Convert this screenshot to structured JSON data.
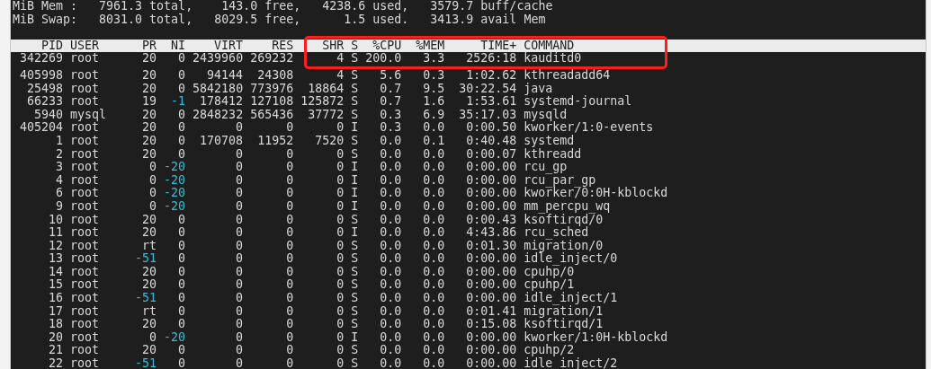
{
  "summary_lines": [
    "MiB Mem :   7961.3 total,    143.0 free,   4238.6 used,   3579.7 buff/cache",
    "MiB Swap:   8031.0 total,   8029.5 free,      1.5 used.   3413.9 avail Mem"
  ],
  "header": {
    "columns": [
      "PID",
      "USER",
      "PR",
      "NI",
      "VIRT",
      "RES",
      "SHR",
      "S",
      "%CPU",
      "%MEM",
      "TIME+",
      "COMMAND"
    ],
    "boxed": true
  },
  "rows": [
    {
      "pid": "342269",
      "user": "root",
      "pr": "20",
      "ni": "0",
      "virt": "2439960",
      "res": "269232",
      "shr": "4",
      "s": "S",
      "cpu": "200.0",
      "mem": "3.3",
      "time": "2526:18",
      "command": "kauditd0",
      "pr_highlighted": false,
      "ni_highlighted": false,
      "boxed": true
    },
    {
      "pid": "405998",
      "user": "root",
      "pr": "20",
      "ni": "0",
      "virt": "94144",
      "res": "24308",
      "shr": "4",
      "s": "S",
      "cpu": "5.6",
      "mem": "0.3",
      "time": "1:02.62",
      "command": "kthreadadd64",
      "pr_highlighted": false,
      "ni_highlighted": false,
      "boxed": false
    },
    {
      "pid": "25498",
      "user": "root",
      "pr": "20",
      "ni": "0",
      "virt": "5842180",
      "res": "773976",
      "shr": "18864",
      "s": "S",
      "cpu": "0.7",
      "mem": "9.5",
      "time": "30:22.54",
      "command": "java",
      "pr_highlighted": false,
      "ni_highlighted": false,
      "boxed": false
    },
    {
      "pid": "66233",
      "user": "root",
      "pr": "19",
      "ni": "-1",
      "virt": "178412",
      "res": "127108",
      "shr": "125872",
      "s": "S",
      "cpu": "0.7",
      "mem": "1.6",
      "time": "1:53.61",
      "command": "systemd-journal",
      "pr_highlighted": false,
      "ni_highlighted": true,
      "boxed": false
    },
    {
      "pid": "5940",
      "user": "mysql",
      "pr": "20",
      "ni": "0",
      "virt": "2848232",
      "res": "565436",
      "shr": "37772",
      "s": "S",
      "cpu": "0.3",
      "mem": "6.9",
      "time": "35:17.03",
      "command": "mysqld",
      "pr_highlighted": false,
      "ni_highlighted": false,
      "boxed": false
    },
    {
      "pid": "405204",
      "user": "root",
      "pr": "20",
      "ni": "0",
      "virt": "0",
      "res": "0",
      "shr": "0",
      "s": "I",
      "cpu": "0.3",
      "mem": "0.0",
      "time": "0:00.50",
      "command": "kworker/1:0-events",
      "pr_highlighted": false,
      "ni_highlighted": false,
      "boxed": false
    },
    {
      "pid": "1",
      "user": "root",
      "pr": "20",
      "ni": "0",
      "virt": "170708",
      "res": "11952",
      "shr": "7520",
      "s": "S",
      "cpu": "0.0",
      "mem": "0.1",
      "time": "0:40.48",
      "command": "systemd",
      "pr_highlighted": false,
      "ni_highlighted": false,
      "boxed": false
    },
    {
      "pid": "2",
      "user": "root",
      "pr": "20",
      "ni": "0",
      "virt": "0",
      "res": "0",
      "shr": "0",
      "s": "S",
      "cpu": "0.0",
      "mem": "0.0",
      "time": "0:00.07",
      "command": "kthreadd",
      "pr_highlighted": false,
      "ni_highlighted": false,
      "boxed": false
    },
    {
      "pid": "3",
      "user": "root",
      "pr": "0",
      "ni": "-20",
      "virt": "0",
      "res": "0",
      "shr": "0",
      "s": "I",
      "cpu": "0.0",
      "mem": "0.0",
      "time": "0:00.00",
      "command": "rcu_gp",
      "pr_highlighted": false,
      "ni_highlighted": true,
      "boxed": false
    },
    {
      "pid": "4",
      "user": "root",
      "pr": "0",
      "ni": "-20",
      "virt": "0",
      "res": "0",
      "shr": "0",
      "s": "I",
      "cpu": "0.0",
      "mem": "0.0",
      "time": "0:00.00",
      "command": "rcu_par_gp",
      "pr_highlighted": false,
      "ni_highlighted": true,
      "boxed": false
    },
    {
      "pid": "6",
      "user": "root",
      "pr": "0",
      "ni": "-20",
      "virt": "0",
      "res": "0",
      "shr": "0",
      "s": "I",
      "cpu": "0.0",
      "mem": "0.0",
      "time": "0:00.00",
      "command": "kworker/0:0H-kblockd",
      "pr_highlighted": false,
      "ni_highlighted": true,
      "boxed": false
    },
    {
      "pid": "9",
      "user": "root",
      "pr": "0",
      "ni": "-20",
      "virt": "0",
      "res": "0",
      "shr": "0",
      "s": "I",
      "cpu": "0.0",
      "mem": "0.0",
      "time": "0:00.00",
      "command": "mm_percpu_wq",
      "pr_highlighted": false,
      "ni_highlighted": true,
      "boxed": false
    },
    {
      "pid": "10",
      "user": "root",
      "pr": "20",
      "ni": "0",
      "virt": "0",
      "res": "0",
      "shr": "0",
      "s": "S",
      "cpu": "0.0",
      "mem": "0.0",
      "time": "0:00.43",
      "command": "ksoftirqd/0",
      "pr_highlighted": false,
      "ni_highlighted": false,
      "boxed": false
    },
    {
      "pid": "11",
      "user": "root",
      "pr": "20",
      "ni": "0",
      "virt": "0",
      "res": "0",
      "shr": "0",
      "s": "I",
      "cpu": "0.0",
      "mem": "0.0",
      "time": "4:43.86",
      "command": "rcu_sched",
      "pr_highlighted": false,
      "ni_highlighted": false,
      "boxed": false
    },
    {
      "pid": "12",
      "user": "root",
      "pr": "rt",
      "ni": "0",
      "virt": "0",
      "res": "0",
      "shr": "0",
      "s": "S",
      "cpu": "0.0",
      "mem": "0.0",
      "time": "0:01.30",
      "command": "migration/0",
      "pr_highlighted": false,
      "ni_highlighted": false,
      "boxed": false
    },
    {
      "pid": "13",
      "user": "root",
      "pr": "-51",
      "ni": "0",
      "virt": "0",
      "res": "0",
      "shr": "0",
      "s": "S",
      "cpu": "0.0",
      "mem": "0.0",
      "time": "0:00.00",
      "command": "idle_inject/0",
      "pr_highlighted": true,
      "ni_highlighted": false,
      "boxed": false
    },
    {
      "pid": "14",
      "user": "root",
      "pr": "20",
      "ni": "0",
      "virt": "0",
      "res": "0",
      "shr": "0",
      "s": "S",
      "cpu": "0.0",
      "mem": "0.0",
      "time": "0:00.00",
      "command": "cpuhp/0",
      "pr_highlighted": false,
      "ni_highlighted": false,
      "boxed": false
    },
    {
      "pid": "15",
      "user": "root",
      "pr": "20",
      "ni": "0",
      "virt": "0",
      "res": "0",
      "shr": "0",
      "s": "S",
      "cpu": "0.0",
      "mem": "0.0",
      "time": "0:00.00",
      "command": "cpuhp/1",
      "pr_highlighted": false,
      "ni_highlighted": false,
      "boxed": false
    },
    {
      "pid": "16",
      "user": "root",
      "pr": "-51",
      "ni": "0",
      "virt": "0",
      "res": "0",
      "shr": "0",
      "s": "S",
      "cpu": "0.0",
      "mem": "0.0",
      "time": "0:00.00",
      "command": "idle_inject/1",
      "pr_highlighted": true,
      "ni_highlighted": false,
      "boxed": false
    },
    {
      "pid": "17",
      "user": "root",
      "pr": "rt",
      "ni": "0",
      "virt": "0",
      "res": "0",
      "shr": "0",
      "s": "S",
      "cpu": "0.0",
      "mem": "0.0",
      "time": "0:01.41",
      "command": "migration/1",
      "pr_highlighted": false,
      "ni_highlighted": false,
      "boxed": false
    },
    {
      "pid": "18",
      "user": "root",
      "pr": "20",
      "ni": "0",
      "virt": "0",
      "res": "0",
      "shr": "0",
      "s": "S",
      "cpu": "0.0",
      "mem": "0.0",
      "time": "0:15.08",
      "command": "ksoftirqd/1",
      "pr_highlighted": false,
      "ni_highlighted": false,
      "boxed": false
    },
    {
      "pid": "20",
      "user": "root",
      "pr": "0",
      "ni": "-20",
      "virt": "0",
      "res": "0",
      "shr": "0",
      "s": "I",
      "cpu": "0.0",
      "mem": "0.0",
      "time": "0:00.00",
      "command": "kworker/1:0H-kblockd",
      "pr_highlighted": false,
      "ni_highlighted": true,
      "boxed": false
    },
    {
      "pid": "21",
      "user": "root",
      "pr": "20",
      "ni": "0",
      "virt": "0",
      "res": "0",
      "shr": "0",
      "s": "S",
      "cpu": "0.0",
      "mem": "0.0",
      "time": "0:00.00",
      "command": "cpuhp/2",
      "pr_highlighted": false,
      "ni_highlighted": false,
      "boxed": false
    },
    {
      "pid": "22",
      "user": "root",
      "pr": "-51",
      "ni": "0",
      "virt": "0",
      "res": "0",
      "shr": "0",
      "s": "S",
      "cpu": "0.0",
      "mem": "0.0",
      "time": "0:00.00",
      "command": "idle_inject/2",
      "pr_highlighted": true,
      "ni_highlighted": false,
      "boxed": false
    }
  ]
}
